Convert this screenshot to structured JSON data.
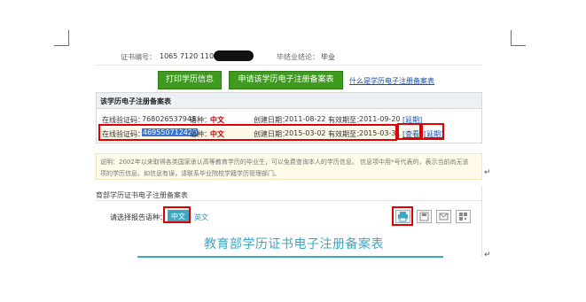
{
  "top_row": {
    "cert_no_label": "证书编号：",
    "cert_no_value": "1065 7120 1105",
    "grad_label": "毕结业结论：",
    "grad_value": "毕业"
  },
  "actions": {
    "print_button": "打印学历信息",
    "apply_button": "申请该学历电子注册备案表",
    "what_link": "什么是学历电子注册备案表"
  },
  "record_section": {
    "title": "该学历电子注册备案表",
    "rows": [
      {
        "code_label": "在线验证码：",
        "code": "768026537948",
        "lang_label": "语种：",
        "lang": "中文",
        "created_label": "创建日期：",
        "created": "2011-08-22",
        "valid_label": "有效期至：",
        "valid": "2011-09-20",
        "action": "[延期]"
      },
      {
        "code_label": "在线验证码：",
        "code": "469550712420",
        "lang_label": "语种：",
        "lang": "中文",
        "created_label": "创建日期：",
        "created": "2015-03-02",
        "valid_label": "有效期至：",
        "valid": "2015-03-31",
        "view": "[查看]",
        "action": "[延期]"
      }
    ]
  },
  "note": {
    "line1": "说明：2002年以来取得各类国家承认高等教育学历的毕业生，可以免费查询本人的学历信息。  信息项中用*号代表的，表示当前尚无该",
    "line2": "项的学历信息。如信息有误，请联系毕业院校学籍学历管理部门。"
  },
  "report": {
    "section_label": "育部学历证书电子注册备案表",
    "lang_select_label": "请选择报告语种：",
    "lang_zh": "中文",
    "lang_en": "英文",
    "title": "教育部学历证书电子注册备案表"
  },
  "colors": {
    "accent_green": "#3f9a20",
    "highlight_red": "#e00000",
    "selection_blue": "#3b74d6",
    "report_title": "#3fa6c4"
  }
}
